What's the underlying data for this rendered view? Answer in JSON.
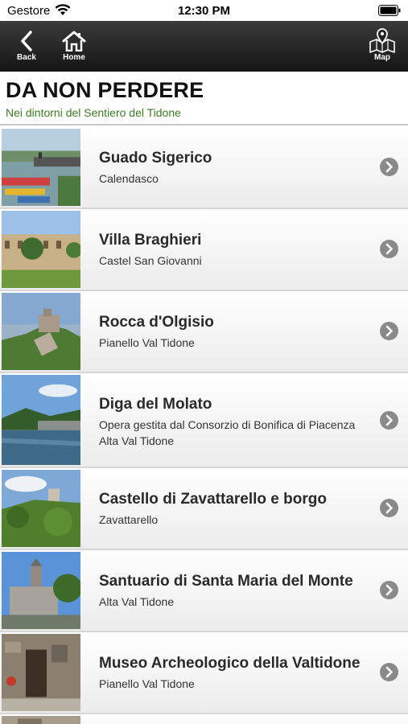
{
  "status": {
    "carrier": "Gestore",
    "time": "12:30 PM"
  },
  "nav": {
    "back_label": "Back",
    "home_label": "Home",
    "map_label": "Map"
  },
  "header": {
    "title": "DA NON PERDERE",
    "subtitle": "Nei dintorni del Sentiero del Tidone"
  },
  "items": [
    {
      "title": "Guado Sigerico",
      "subtitle": "Calendasco"
    },
    {
      "title": "Villa Braghieri",
      "subtitle": "Castel San Giovanni"
    },
    {
      "title": "Rocca d'Olgisio",
      "subtitle": "Pianello Val Tidone"
    },
    {
      "title": "Diga del Molato",
      "subtitle": "Opera gestita dal Consorzio di Bonifica di Piacenza Alta Val Tidone"
    },
    {
      "title": "Castello di Zavattarello e borgo",
      "subtitle": "Zavattarello"
    },
    {
      "title": "Santuario di Santa Maria del Monte",
      "subtitle": "Alta Val Tidone"
    },
    {
      "title": "Museo Archeologico della Valtidone",
      "subtitle": "Pianello Val Tidone"
    }
  ],
  "colors": {
    "subtitle_green": "#3c7d1e",
    "nav_bg": "#1f1f1f",
    "chevron": "#8a8a8a"
  }
}
